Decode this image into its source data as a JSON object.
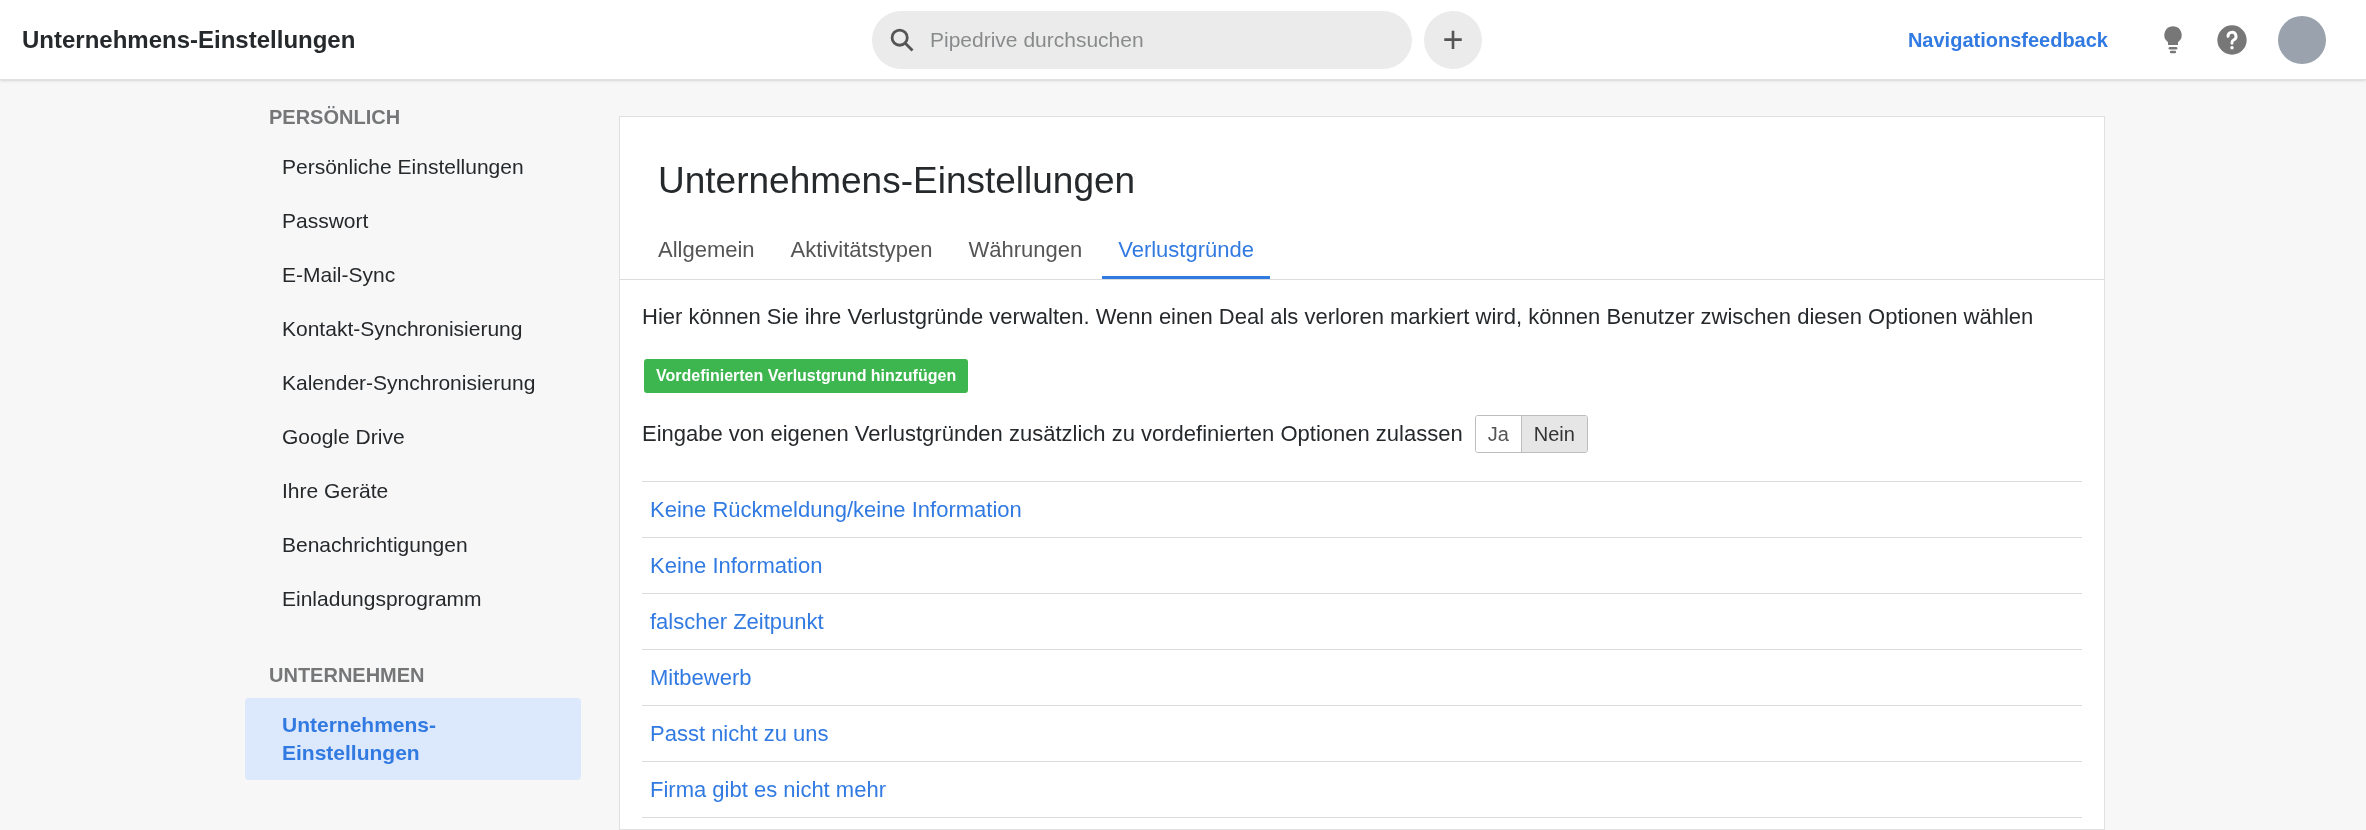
{
  "header": {
    "title": "Unternehmens-Einstellungen",
    "search": {
      "placeholder": "Pipedrive durchsuchen"
    },
    "add_button": "+",
    "feedback_link": "Navigationsfeedback"
  },
  "sidebar": {
    "sections": [
      {
        "heading": "PERSÖNLICH",
        "items": [
          {
            "label": "Persönliche Einstellungen",
            "selected": false
          },
          {
            "label": "Passwort",
            "selected": false
          },
          {
            "label": "E-Mail-Sync",
            "selected": false
          },
          {
            "label": "Kontakt-Synchronisierung",
            "selected": false
          },
          {
            "label": "Kalender-Synchronisierung",
            "selected": false
          },
          {
            "label": "Google Drive",
            "selected": false
          },
          {
            "label": "Ihre Geräte",
            "selected": false
          },
          {
            "label": "Benachrichtigungen",
            "selected": false
          },
          {
            "label": "Einladungsprogramm",
            "selected": false
          }
        ]
      },
      {
        "heading": "UNTERNEHMEN",
        "items": [
          {
            "label": "Unternehmens-Einstellungen",
            "selected": true
          }
        ]
      }
    ]
  },
  "content": {
    "title": "Unternehmens-Einstellungen",
    "tabs": [
      {
        "label": "Allgemein",
        "selected": false
      },
      {
        "label": "Aktivitätstypen",
        "selected": false
      },
      {
        "label": "Währungen",
        "selected": false
      },
      {
        "label": "Verlustgründe",
        "selected": true
      }
    ],
    "description": "Hier können Sie ihre Verlustgründe verwalten. Wenn einen Deal als verloren markiert wird, können Benutzer zwischen diesen Optionen wählen",
    "add_button": "Vordefinierten Verlustgrund hinzufügen",
    "custom_reasons": {
      "label": "Eingabe von eigenen Verlustgründen zusätzlich zu vordefinierten Optionen zulassen",
      "options": [
        {
          "label": "Ja",
          "selected": false
        },
        {
          "label": "Nein",
          "selected": true
        }
      ]
    },
    "reasons": [
      "Keine Rückmeldung/keine Information",
      "Keine Information",
      "falscher Zeitpunkt",
      "Mitbewerb",
      "Passt nicht zu uns",
      "Firma gibt es nicht mehr"
    ]
  }
}
